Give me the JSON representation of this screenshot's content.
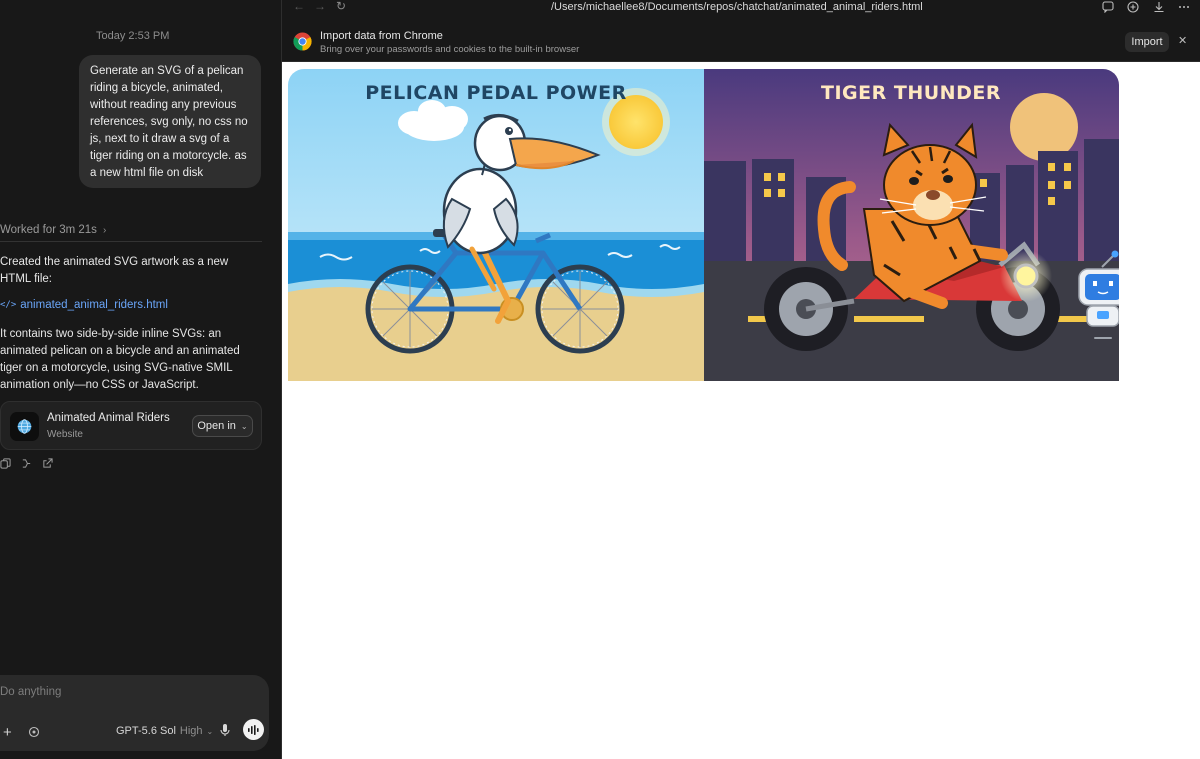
{
  "chat": {
    "timestamp": "Today 2:53 PM",
    "user_message": "Generate an SVG of a pelican riding a bicycle, animated, without reading any previous references, svg only, no css no js, next to it draw a svg of a tiger riding on a motorcycle. as a new html file on disk",
    "worked_label": "Worked for 3m 21s",
    "reply_intro": "Created the animated SVG artwork as a new HTML file:",
    "file_link": "animated_animal_riders.html",
    "reply_body": "It contains two side-by-side inline SVGs: an animated pelican on a bicycle and an animated tiger on a motorcycle, using SVG-native SMIL animation only—no CSS or JavaScript.",
    "card": {
      "title": "Animated Animal Riders",
      "subtitle": "Website",
      "open_label": "Open in",
      "icon": "globe-icon"
    },
    "actions": [
      "copy-icon",
      "fork-icon",
      "share-icon"
    ]
  },
  "composer": {
    "placeholder": "Do anything",
    "model": "GPT-5.6 Sol",
    "level": "High"
  },
  "browser": {
    "url": "/Users/michaellee8/Documents/repos/chatchat/animated_animal_riders.html",
    "import_title": "Import data from Chrome",
    "import_subtitle": "Bring over your passwords and cookies to the built-in browser",
    "import_button": "Import",
    "toolbar_icons": [
      "back-icon",
      "forward-icon",
      "reload-icon",
      "comment-icon",
      "add-icon",
      "download-icon",
      "more-icon"
    ]
  },
  "page": {
    "pelican_title": "PELICAN PEDAL POWER",
    "tiger_title": "TIGER THUNDER"
  },
  "colors": {
    "sidebar_bg": "#181818",
    "bubble_bg": "#2f2f2f",
    "link": "#6aa5f8",
    "pelican_title": "#1f4664",
    "tiger_title": "#ffe8bf",
    "tiger_orange": "#f08a2c"
  }
}
